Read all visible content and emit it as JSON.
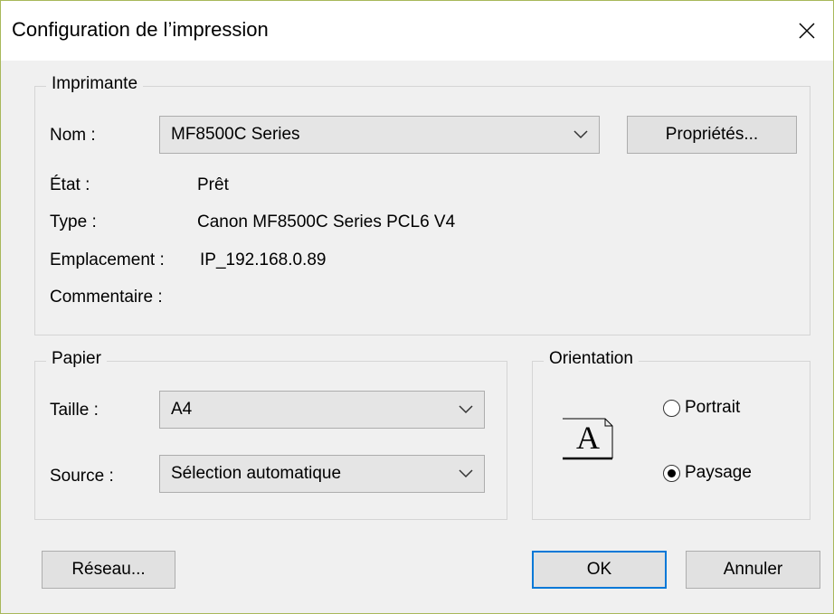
{
  "window": {
    "title": "Configuration de l’impression"
  },
  "printer": {
    "group_label": "Imprimante",
    "name_label": "Nom :",
    "name_value": "MF8500C Series",
    "properties_button": "Propriétés...",
    "status_label": "État :",
    "status_value": "Prêt",
    "type_label": "Type :",
    "type_value": "Canon MF8500C Series PCL6 V4",
    "location_label": "Emplacement :",
    "location_value": "IP_192.168.0.89",
    "comment_label": "Commentaire :",
    "comment_value": ""
  },
  "paper": {
    "group_label": "Papier",
    "size_label": "Taille :",
    "size_value": "A4",
    "source_label": "Source :",
    "source_value": "Sélection automatique"
  },
  "orientation": {
    "group_label": "Orientation",
    "preview_letter": "A",
    "options": [
      {
        "label": "Portrait",
        "selected": false
      },
      {
        "label": "Paysage",
        "selected": true
      }
    ]
  },
  "buttons": {
    "network": "Réseau...",
    "ok": "OK",
    "cancel": "Annuler"
  },
  "colors": {
    "window_border": "#a8b85a",
    "default_button_border": "#0078d7"
  },
  "icons": {
    "close": "close-icon",
    "dropdown": "chevron-down-icon",
    "orientation_preview": "page-landscape-icon"
  }
}
